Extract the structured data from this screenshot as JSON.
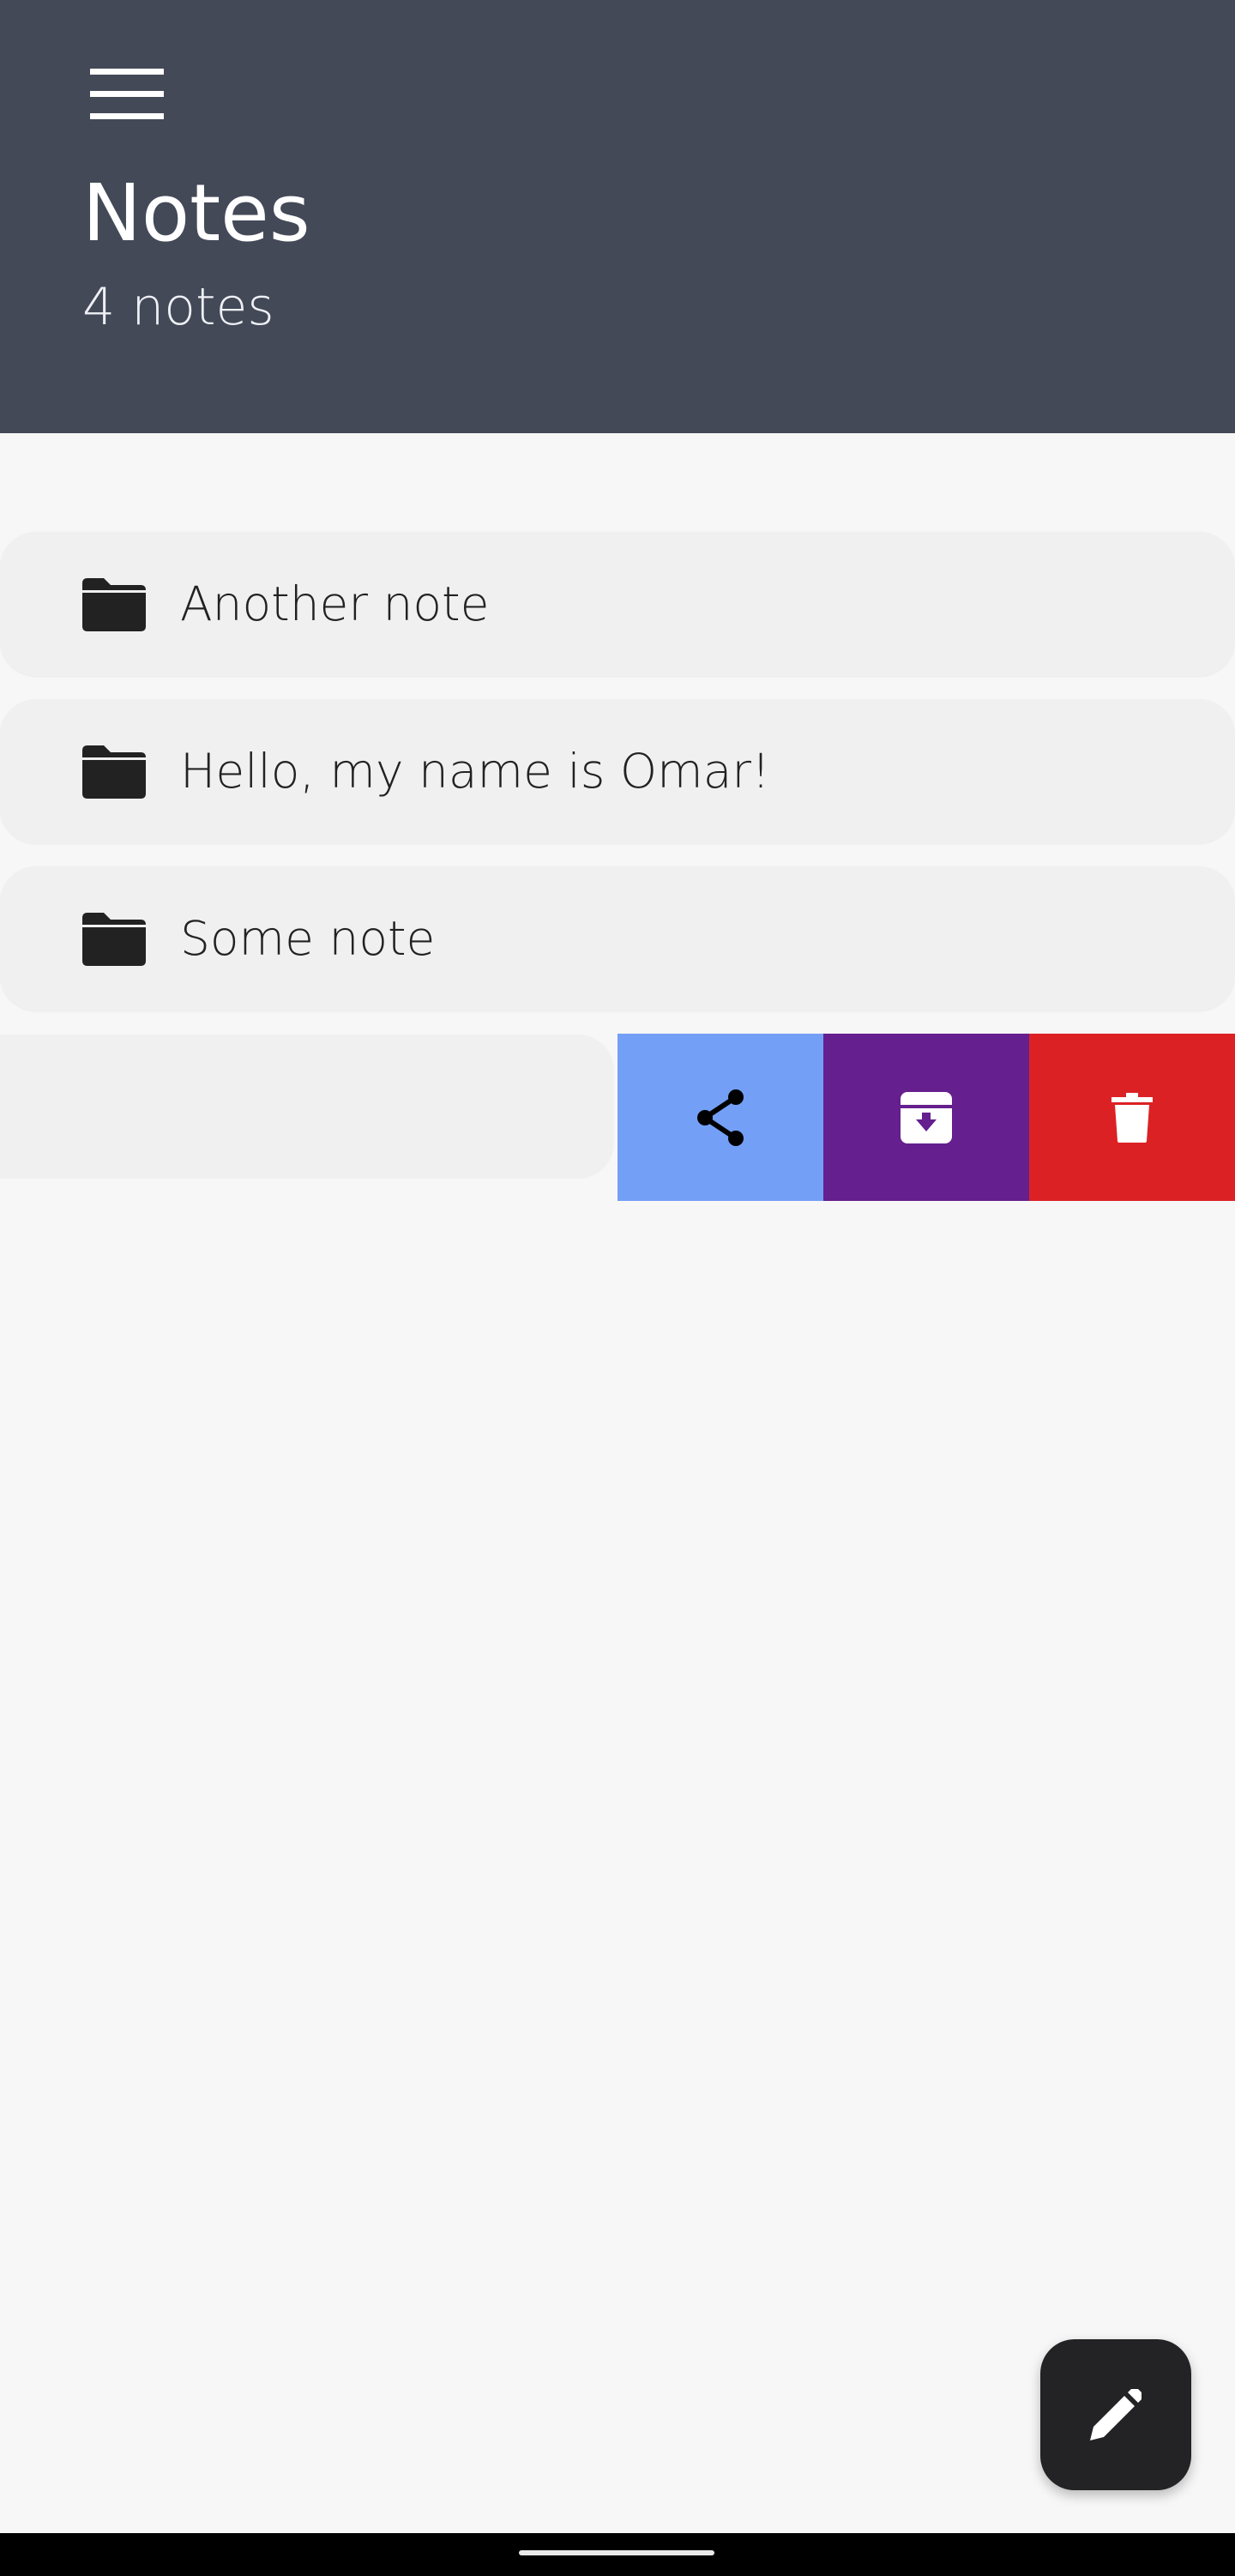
{
  "header": {
    "title": "Notes",
    "subtitle": "4 notes",
    "background_color": "#434957"
  },
  "menu": {
    "icon": "hamburger-menu-icon"
  },
  "notes": [
    {
      "label": "Another note",
      "icon": "folder-icon"
    },
    {
      "label": "Hello, my name is Omar!",
      "icon": "folder-icon"
    },
    {
      "label": "Some note",
      "icon": "folder-icon"
    }
  ],
  "swipe_actions": {
    "share": {
      "icon": "share-icon",
      "color": "#739ff7"
    },
    "archive": {
      "icon": "archive-icon",
      "color": "#651f8e"
    },
    "delete": {
      "icon": "trash-icon",
      "color": "#dc2124"
    }
  },
  "fab": {
    "icon": "pencil-icon",
    "color": "#232326"
  }
}
